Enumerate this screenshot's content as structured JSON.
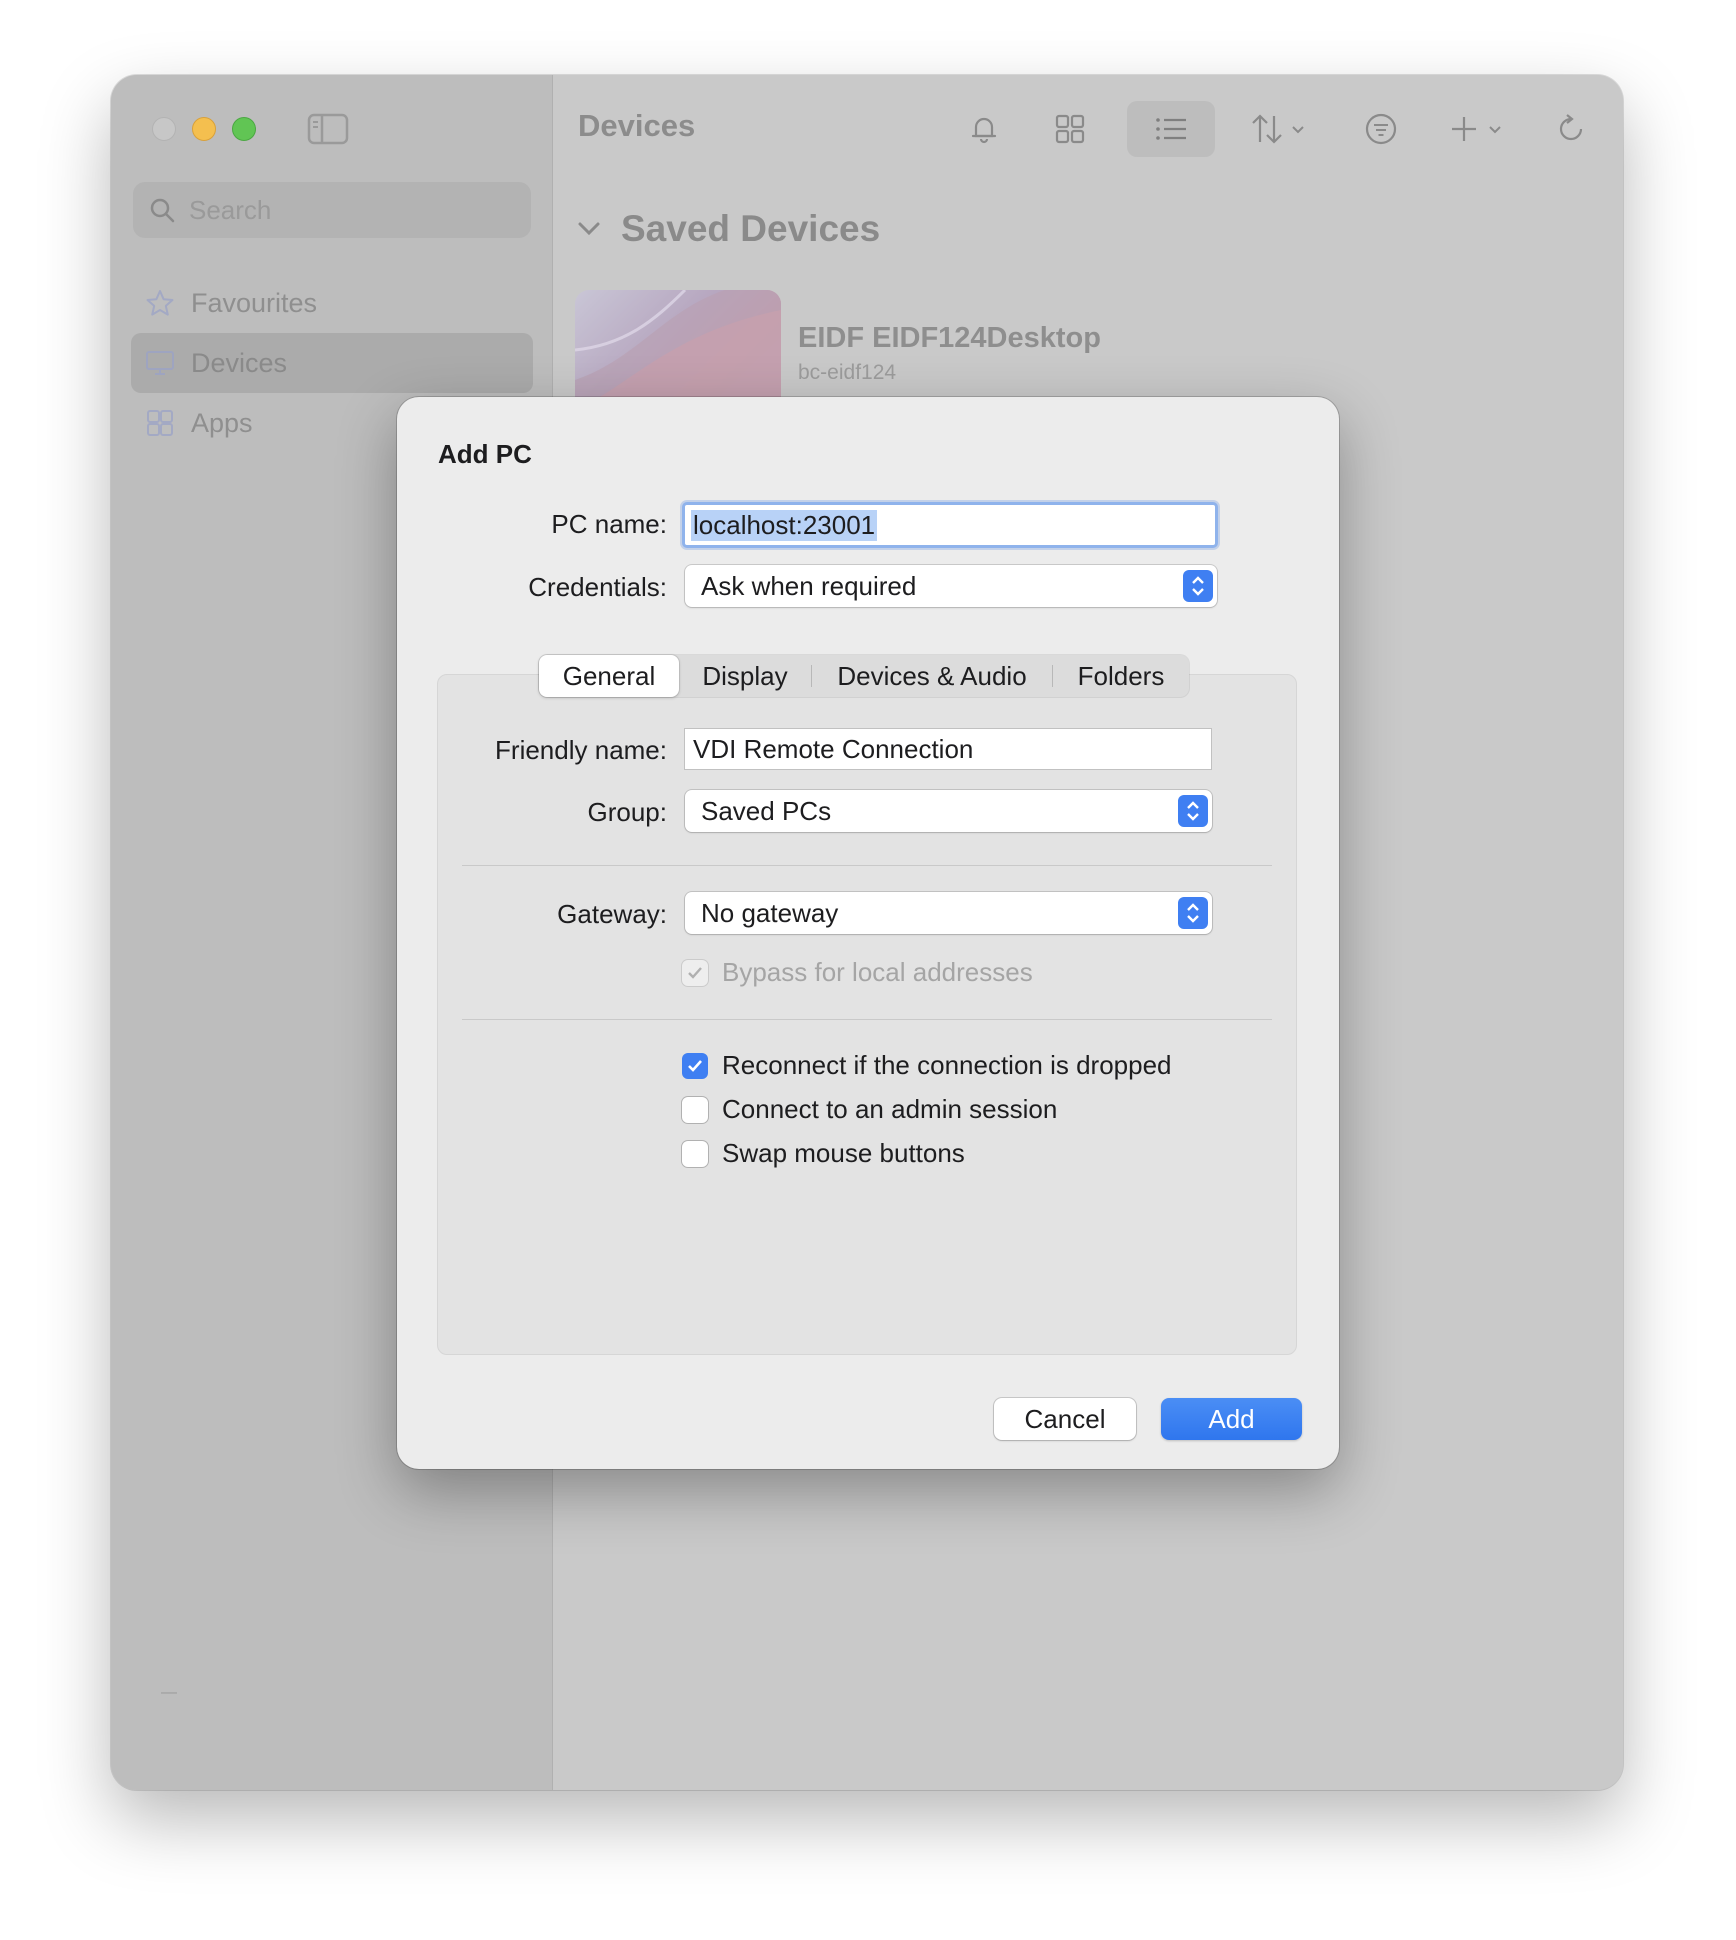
{
  "sidebar": {
    "search_placeholder": "Search",
    "items": [
      {
        "label": "Favourites",
        "icon": "star-icon"
      },
      {
        "label": "Devices",
        "icon": "monitor-icon",
        "selected": true
      },
      {
        "label": "Apps",
        "icon": "apps-icon"
      }
    ],
    "footer": "—"
  },
  "content": {
    "title": "Devices",
    "toolbar": [
      "bell-icon",
      "grid-view-icon",
      "list-view-icon",
      "sort-icon",
      "filter-icon",
      "add-icon",
      "refresh-icon"
    ],
    "section_title": "Saved Devices",
    "device": {
      "name": "EIDF EIDF124Desktop",
      "host": "bc-eidf124"
    }
  },
  "dialog": {
    "title": "Add PC",
    "pc_name_label": "PC name:",
    "pc_name_value": "localhost:23001",
    "credentials_label": "Credentials:",
    "credentials_value": "Ask when required",
    "tabs": [
      "General",
      "Display",
      "Devices & Audio",
      "Folders"
    ],
    "selected_tab": "General",
    "friendly_name_label": "Friendly name:",
    "friendly_name_value": "VDI Remote Connection",
    "group_label": "Group:",
    "group_value": "Saved PCs",
    "gateway_label": "Gateway:",
    "gateway_value": "No gateway",
    "bypass_label": "Bypass for local addresses",
    "bypass_checked": true,
    "checkboxes": [
      {
        "label": "Reconnect if the connection is dropped",
        "checked": true
      },
      {
        "label": "Connect to an admin session",
        "checked": false
      },
      {
        "label": "Swap mouse buttons",
        "checked": false
      }
    ],
    "cancel_label": "Cancel",
    "add_label": "Add"
  },
  "colors": {
    "accent": "#3f7ff2",
    "close": "#c7c7c7",
    "minimize": "#f4bf4f",
    "maximize": "#61c554"
  }
}
